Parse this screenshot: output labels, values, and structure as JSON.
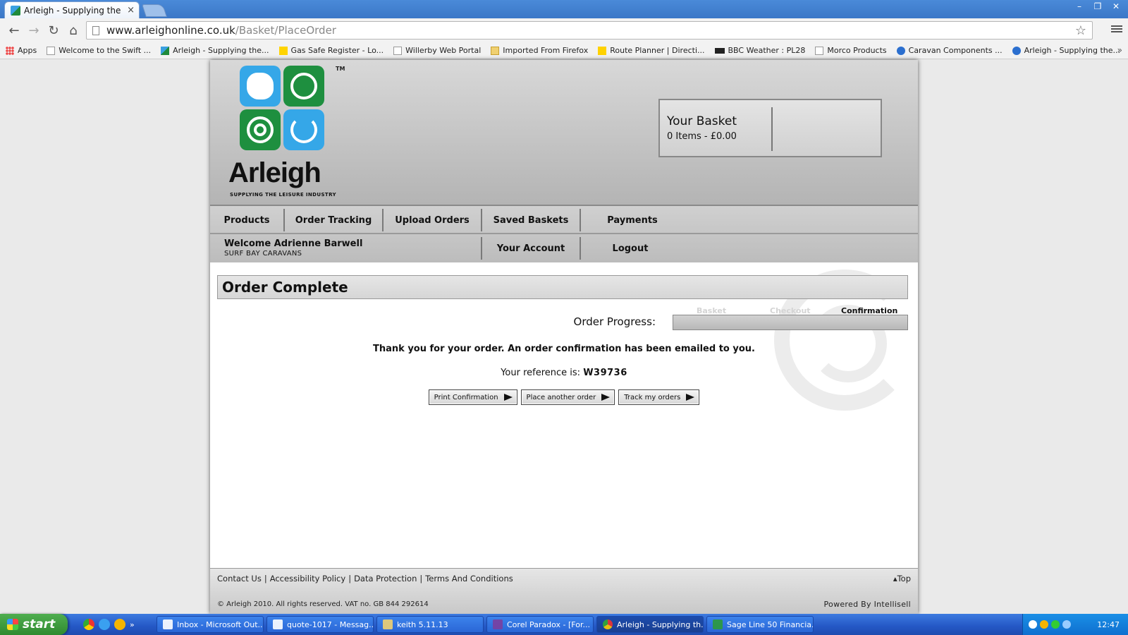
{
  "browser": {
    "tab_title": "Arleigh - Supplying the Leisu",
    "tab_close": "×",
    "url_host": "www.arleighonline.co.uk",
    "url_path": "/Basket/PlaceOrder",
    "window_controls": [
      "–",
      "❐",
      "✕"
    ],
    "bookmarks": [
      {
        "label": "Apps",
        "icon": "apps-icon"
      },
      {
        "label": "Welcome to the Swift ...",
        "icon": "page-icon"
      },
      {
        "label": "Arleigh - Supplying the...",
        "icon": "arleigh-icon"
      },
      {
        "label": "Gas Safe Register - Lo...",
        "icon": "gas-safe-icon"
      },
      {
        "label": "Willerby Web Portal",
        "icon": "page-icon"
      },
      {
        "label": "Imported From Firefox",
        "icon": "folder-icon"
      },
      {
        "label": "Route Planner | Directi...",
        "icon": "aa-icon"
      },
      {
        "label": "BBC Weather : PL28",
        "icon": "bbc-icon"
      },
      {
        "label": "Morco Products",
        "icon": "morco-icon"
      },
      {
        "label": "Caravan Components ...",
        "icon": "caravan-icon"
      },
      {
        "label": "Arleigh - Supplying the...",
        "icon": "arleigh-swirl-icon"
      }
    ],
    "bookmarks_more": "»"
  },
  "header": {
    "logo_text": "Arleigh",
    "logo_tagline": "SUPPLYING THE LEISURE INDUSTRY",
    "logo_tm": "TM",
    "basket_title": "Your Basket",
    "basket_summary": "0 Items - £0.00"
  },
  "nav": {
    "row1": [
      "Products",
      "Order Tracking",
      "Upload Orders",
      "Saved Baskets",
      "Payments"
    ],
    "welcome_name": "Welcome Adrienne Barwell",
    "welcome_company": "SURF BAY CARAVANS",
    "row2": [
      "Your Account",
      "Logout"
    ]
  },
  "main": {
    "title": "Order Complete",
    "progress_steps": [
      "Basket",
      "Checkout",
      "Confirmation"
    ],
    "progress_label": "Order Progress:",
    "progress_fraction": 1.0,
    "thanks": "Thank you for your order. An order confirmation has been emailed to you.",
    "reference_label": "Your reference is:",
    "reference_value": "W39736",
    "buttons": [
      "Print Confirmation",
      "Place another order",
      "Track my orders"
    ]
  },
  "footer": {
    "links": [
      "Contact Us",
      "Accessibility Policy",
      "Data Protection",
      "Terms And Conditions"
    ],
    "separator": "|",
    "top_link": "▴Top",
    "copyright": "© Arleigh 2010. All rights reserved. VAT no. GB 844 292614",
    "powered_by": "Powered By Intellisell"
  },
  "taskbar": {
    "start_label": "start",
    "quick_more": "»",
    "tasks": [
      "Inbox - Microsoft Out...",
      "quote-1017 - Messag...",
      "keith 5.11.13",
      "Corel Paradox - [For...",
      "Arleigh - Supplying th...",
      "Sage Line 50 Financia..."
    ],
    "active_task": 4,
    "clock": "12:47"
  },
  "colors": {
    "brand_blue": "#35a7e8",
    "brand_green": "#1e8f3f",
    "taskbar_blue": "#2457c5"
  }
}
